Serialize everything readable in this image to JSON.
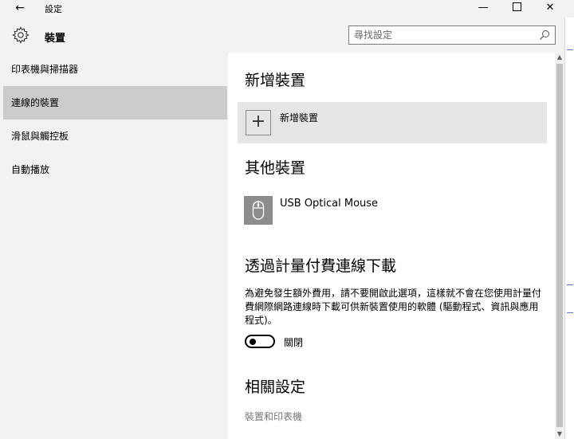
{
  "window": {
    "title": "設定",
    "back_glyph": "←",
    "minimize_glyph": "—",
    "close_glyph": "✕"
  },
  "header": {
    "title": "裝置",
    "search_placeholder": "尋找設定"
  },
  "sidebar": {
    "items": [
      {
        "label": "印表機與掃描器",
        "active": false
      },
      {
        "label": "連線的裝置",
        "active": true
      },
      {
        "label": "滑鼠與觸控板",
        "active": false
      },
      {
        "label": "自動播放",
        "active": false
      }
    ]
  },
  "content": {
    "add_section_title": "新增裝置",
    "add_button_label": "新增裝置",
    "add_button_glyph": "+",
    "other_section_title": "其他裝置",
    "device_name": "USB Optical Mouse",
    "metered_title": "透過計量付費連線下載",
    "metered_desc": "為避免發生額外費用，請不要開啟此選項，這樣就不會在您使用計量付費網際網路連線時下載可供新裝置使用的軟體 (驅動程式、資訊與應用程式)。",
    "toggle_state": "關閉",
    "related_title": "相關設定",
    "related_link": "裝置和印表機"
  },
  "icons": {
    "header": "gear-icon",
    "search": "search-icon",
    "add": "plus-icon",
    "device": "mouse-icon"
  },
  "colors": {
    "active_nav": "#cccccc",
    "window_bg": "#f2f2f2",
    "add_tile_bg": "#e6e6e6",
    "device_icon_bg": "#8c8c8c",
    "link": "#767676"
  }
}
